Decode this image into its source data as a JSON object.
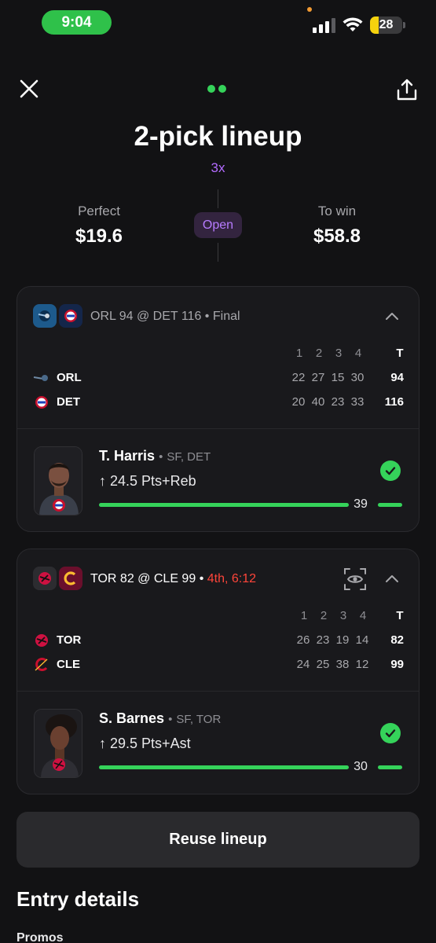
{
  "status_bar": {
    "time": "9:04",
    "battery": "28"
  },
  "header": {
    "title": "2-pick lineup",
    "multiplier": "3x"
  },
  "summary": {
    "perfect_label": "Perfect",
    "perfect_value": "$19.6",
    "status_badge": "Open",
    "towin_label": "To win",
    "towin_value": "$58.8"
  },
  "games": [
    {
      "matchup": "ORL 94 @ DET 116",
      "separator": "•",
      "status": "Final",
      "quarters_header": [
        "1",
        "2",
        "3",
        "4"
      ],
      "total_header": "T",
      "teams": [
        {
          "abbr": "ORL",
          "scores": [
            "22",
            "27",
            "15",
            "30"
          ],
          "total": "94",
          "color": "#0077c0"
        },
        {
          "abbr": "DET",
          "scores": [
            "20",
            "40",
            "23",
            "33"
          ],
          "total": "116",
          "color": "#c8102e"
        }
      ],
      "player": {
        "name": "T. Harris",
        "meta": "SF, DET",
        "arrow": "↑",
        "prop": "24.5 Pts+Reb",
        "result": "39",
        "progress": 1.0
      }
    },
    {
      "matchup": "TOR 82 @ CLE 99",
      "separator": "•",
      "status": "4th, 6:12",
      "quarters_header": [
        "1",
        "2",
        "3",
        "4"
      ],
      "total_header": "T",
      "teams": [
        {
          "abbr": "TOR",
          "scores": [
            "26",
            "23",
            "19",
            "14"
          ],
          "total": "82",
          "color": "#ce1141"
        },
        {
          "abbr": "CLE",
          "scores": [
            "24",
            "25",
            "38",
            "12"
          ],
          "total": "99",
          "color": "#860038"
        }
      ],
      "player": {
        "name": "S. Barnes",
        "meta": "SF, TOR",
        "arrow": "↑",
        "prop": "29.5 Pts+Ast",
        "result": "30",
        "progress": 1.0
      }
    }
  ],
  "actions": {
    "reuse": "Reuse lineup"
  },
  "entry_details": {
    "title": "Entry details",
    "promos": "Promos"
  },
  "colors": {
    "accent_green": "#35d35a",
    "accent_purple": "#b36bff",
    "live_red": "#ff453a"
  }
}
